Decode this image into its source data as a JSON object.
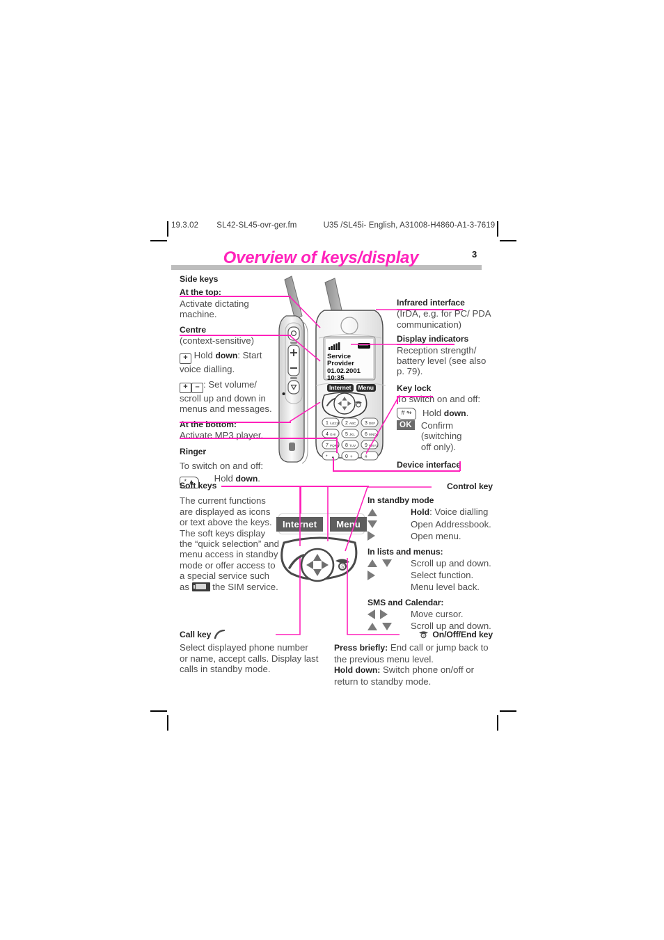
{
  "running_head": {
    "date": "19.3.02",
    "filename": "SL42-SL45-ovr-ger.fm",
    "doc_ref": "U35 /SL45i- English, A31008-H4860-A1-3-7619"
  },
  "title": "Overview of keys/display",
  "page_number": "3",
  "side_keys": {
    "heading": "Side keys",
    "top": {
      "heading": "At the top:",
      "body": "Activate dictating machine."
    },
    "centre": {
      "heading": "Centre",
      "sub": "(context-sensitive)",
      "line1_prefix": "Hold ",
      "line1_bold": "down",
      "line1_suffix": ": Start voice dialling.",
      "line2": ": Set volume/ scroll up and down in menus and messages.",
      "plus_key": "+",
      "minus_key": "–"
    },
    "bottom": {
      "heading": "At the bottom:",
      "body": "Activate MP3 player."
    },
    "ringer": {
      "heading": "Ringer",
      "body": "To switch on and off:",
      "key_glyph": "star-key",
      "action_prefix": "Hold ",
      "action_bold": "down",
      "action_suffix": "."
    }
  },
  "infrared": {
    "heading": "Infrared interface",
    "body": "(IrDA, e.g. for PC/ PDA communication)"
  },
  "display_indicators": {
    "heading": "Display indicators",
    "body": "Reception strength/ battery level (see  also p. 79)."
  },
  "key_lock": {
    "heading": "Key lock",
    "body": "To switch on and off:",
    "row1_prefix": "Hold ",
    "row1_bold": "down",
    "row1_suffix": ".",
    "row2_badge": "OK",
    "row2_text": "Confirm (switching off only)."
  },
  "device_interface": {
    "heading": "Device interface"
  },
  "soft_keys": {
    "heading": "Soft keys",
    "body_1": "The current functions are displayed as icons or text above the keys. The soft keys display the “quick selection” and menu access in standby mode or offer access to a special service such as ",
    "body_2": "the SIM service."
  },
  "control_key": {
    "heading": "Control key",
    "standby": {
      "heading": "In standby mode",
      "rows": [
        {
          "icons": [
            "up"
          ],
          "bold": "Hold",
          "text": ": Voice dialling"
        },
        {
          "icons": [
            "down"
          ],
          "bold": "",
          "text": "Open Addressbook."
        },
        {
          "icons": [
            "right"
          ],
          "bold": "",
          "text": "Open menu."
        }
      ]
    },
    "lists": {
      "heading": "In lists and menus:",
      "rows": [
        {
          "icons": [
            "up",
            "down"
          ],
          "bold": "",
          "text": "Scroll up and down."
        },
        {
          "icons": [
            "right"
          ],
          "bold": "",
          "text": "Select function."
        },
        {
          "icons": [],
          "bold": "",
          "text": "Menu level back."
        }
      ]
    },
    "sms": {
      "heading": "SMS and Calendar:",
      "rows": [
        {
          "icons": [
            "left",
            "right"
          ],
          "bold": "",
          "text": "Move cursor."
        },
        {
          "icons": [
            "up",
            "down"
          ],
          "bold": "",
          "text": "Scroll up and down."
        }
      ]
    }
  },
  "call_key": {
    "heading": "Call key",
    "body": "Select displayed phone number or name, accept calls. Display last calls in standby mode."
  },
  "end_key": {
    "heading": "On/Off/End key",
    "row1_bold": "Press briefly:",
    "row1_text": " End call or jump back to the previous menu level.",
    "row2_bold": "Hold down:",
    "row2_text": " Switch phone on/off or return to standby mode."
  },
  "phone_display": {
    "provider": "Service Provider",
    "datetime": "01.02.2001 10:35",
    "soft_left": "Internet",
    "soft_right": "Menu",
    "signal_icon": "signal-strength-icon",
    "battery_icon": "battery-level-icon"
  },
  "soft_key_diagram": {
    "left_label": "Internet",
    "right_label": "Menu"
  },
  "colors": {
    "accent": "#ff22bb",
    "rule": "#bdbdbd",
    "text": "#4d4d4d",
    "heading": "#262626"
  }
}
